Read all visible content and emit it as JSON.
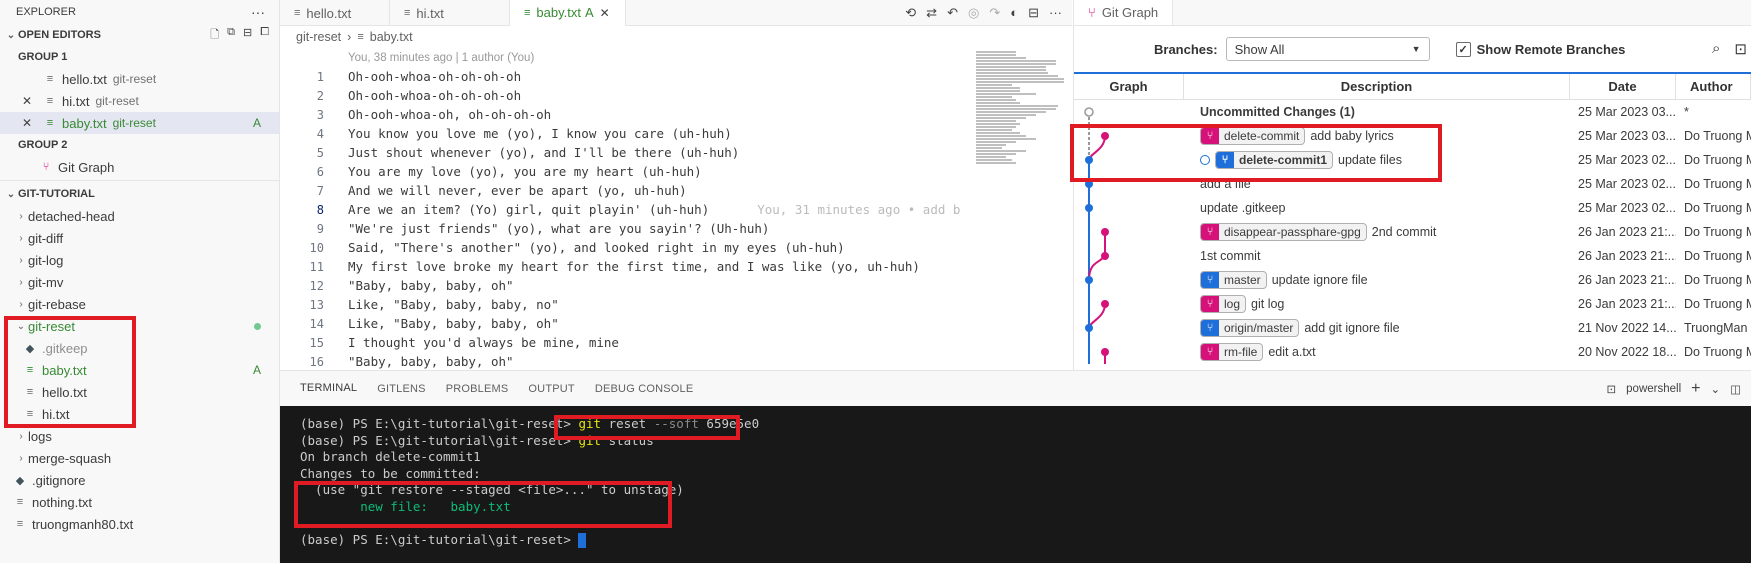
{
  "sidebar": {
    "title": "EXPLORER",
    "more": "···",
    "open_editors": {
      "label": "OPEN EDITORS",
      "groups": [
        {
          "label": "GROUP 1",
          "items": [
            {
              "name": "hello.txt",
              "desc": "git-reset",
              "close": "",
              "badge": ""
            },
            {
              "name": "hi.txt",
              "desc": "git-reset",
              "close": "✕",
              "badge": ""
            },
            {
              "name": "baby.txt",
              "desc": "git-reset",
              "close": "✕",
              "badge": "A"
            }
          ]
        },
        {
          "label": "GROUP 2",
          "items": [
            {
              "name": "Git Graph"
            }
          ]
        }
      ]
    },
    "workspace": {
      "label": "GIT-TUTORIAL",
      "folders_top": [
        "detached-head",
        "git-diff",
        "git-log",
        "git-mv",
        "git-rebase"
      ],
      "open_folder": "git-reset",
      "open_files": [
        {
          "name": ".gitkeep",
          "badge": ""
        },
        {
          "name": "baby.txt",
          "badge": "A"
        },
        {
          "name": "hello.txt",
          "badge": ""
        },
        {
          "name": "hi.txt",
          "badge": ""
        }
      ],
      "folders_bottom": [
        "logs",
        "merge-squash"
      ],
      "root_files": [
        ".gitignore",
        "nothing.txt",
        "truongmanh80.txt"
      ]
    }
  },
  "tabs": [
    {
      "label": "hello.txt",
      "status": ""
    },
    {
      "label": "hi.txt",
      "status": ""
    },
    {
      "label": "baby.txt",
      "status": "A"
    }
  ],
  "breadcrumb": {
    "folder": "git-reset",
    "sep": "›",
    "file": "baby.txt"
  },
  "blame_header": "You, 38 minutes ago | 1 author (You)",
  "inline_blame": "You, 31 minutes ago • add b",
  "code": [
    {
      "n": "1",
      "t": "Oh-ooh-whoa-oh-oh-oh-oh"
    },
    {
      "n": "2",
      "t": "Oh-ooh-whoa-oh-oh-oh-oh"
    },
    {
      "n": "3",
      "t": "Oh-ooh-whoa-oh, oh-oh-oh-oh"
    },
    {
      "n": "4",
      "t": "You know you love me (yo), I know you care (uh-huh)"
    },
    {
      "n": "5",
      "t": "Just shout whenever (yo), and I'll be there (uh-huh)"
    },
    {
      "n": "6",
      "t": "You are my love (yo), you are my heart (uh-huh)"
    },
    {
      "n": "7",
      "t": "And we will never, ever be apart (yo, uh-huh)"
    },
    {
      "n": "8",
      "t": "Are we an item? (Yo) girl, quit playin' (uh-huh)"
    },
    {
      "n": "9",
      "t": "\"We're just friends\" (yo), what are you sayin'? (Uh-huh)"
    },
    {
      "n": "10",
      "t": "Said, \"There's another\" (yo), and looked right in my eyes (uh-huh)"
    },
    {
      "n": "11",
      "t": "My first love broke my heart for the first time, and I was like (yo, uh-huh)"
    },
    {
      "n": "12",
      "t": "\"Baby, baby, baby, oh\""
    },
    {
      "n": "13",
      "t": "Like, \"Baby, baby, baby, no\""
    },
    {
      "n": "14",
      "t": "Like, \"Baby, baby, baby, oh\""
    },
    {
      "n": "15",
      "t": "I thought you'd always be mine, mine"
    },
    {
      "n": "16",
      "t": "\"Baby, baby, baby, oh\""
    }
  ],
  "git_graph": {
    "tab_label": "Git Graph",
    "branches_label": "Branches:",
    "branches_value": "Show All",
    "show_remote_label": "Show Remote Branches",
    "columns": [
      "Graph",
      "Description",
      "Date",
      "Author"
    ],
    "rows": [
      {
        "desc": "Uncommitted Changes (1)",
        "ref": "",
        "ref_color": "",
        "ref_bold": false,
        "date": "25 Mar 2023 03...",
        "author": "*"
      },
      {
        "desc": "add baby lyrics",
        "ref": "delete-commit",
        "ref_color": "#d6127a",
        "ref_bold": false,
        "date": "25 Mar 2023 03...",
        "author": "Do Truong M"
      },
      {
        "desc": "update files",
        "ref": "delete-commit1",
        "ref_color": "#1e6fd9",
        "ref_bold": true,
        "date": "25 Mar 2023 02...",
        "author": "Do Truong M"
      },
      {
        "desc": "add a file",
        "ref": "",
        "ref_color": "",
        "ref_bold": false,
        "date": "25 Mar 2023 02...",
        "author": "Do Truong M"
      },
      {
        "desc": "update .gitkeep",
        "ref": "",
        "ref_color": "",
        "ref_bold": false,
        "date": "25 Mar 2023 02...",
        "author": "Do Truong M"
      },
      {
        "desc": "2nd commit",
        "ref": "disappear-passphare-gpg",
        "ref_color": "#d6127a",
        "ref_bold": false,
        "date": "26 Jan 2023 21:...",
        "author": "Do Truong M"
      },
      {
        "desc": "1st commit",
        "ref": "",
        "ref_color": "",
        "ref_bold": false,
        "date": "26 Jan 2023 21:...",
        "author": "Do Truong M"
      },
      {
        "desc": "update ignore file",
        "ref": "master",
        "ref_color": "#1e6fd9",
        "ref_bold": false,
        "date": "26 Jan 2023 21:...",
        "author": "Do Truong M"
      },
      {
        "desc": "git log",
        "ref": "log",
        "ref_color": "#d6127a",
        "ref_bold": false,
        "date": "26 Jan 2023 21:...",
        "author": "Do Truong M"
      },
      {
        "desc": "add git ignore file",
        "ref": "origin/master",
        "ref_color": "#1e6fd9",
        "ref_bold": false,
        "date": "21 Nov 2022 14...",
        "author": "TruongMan"
      },
      {
        "desc": "edit a.txt",
        "ref": "rm-file",
        "ref_color": "#d6127a",
        "ref_bold": false,
        "date": "20 Nov 2022 18...",
        "author": "Do Truong M"
      }
    ]
  },
  "panel": {
    "tabs": [
      "TERMINAL",
      "GITLENS",
      "PROBLEMS",
      "OUTPUT",
      "DEBUG CONSOLE"
    ],
    "shell": "powershell",
    "add": "+",
    "terminal": {
      "prompt": "(base) PS E:\\git-tutorial\\git-reset>",
      "cmd1_a": "git",
      "cmd1_b": " reset ",
      "cmd1_c": "--soft",
      "cmd1_d": " 659e5e0",
      "cmd2_a": "git",
      "cmd2_b": " status",
      "l3": "On branch delete-commit1",
      "l4": "Changes to be committed:",
      "l5": "  (use \"git restore --staged <file>...\" to unstage)",
      "l6": "        new file:   baby.txt"
    }
  },
  "colors": {
    "accent": "#1e6fd9",
    "pink": "#d6127a",
    "highlight_box": "#e01b24",
    "added": "#388a34"
  }
}
